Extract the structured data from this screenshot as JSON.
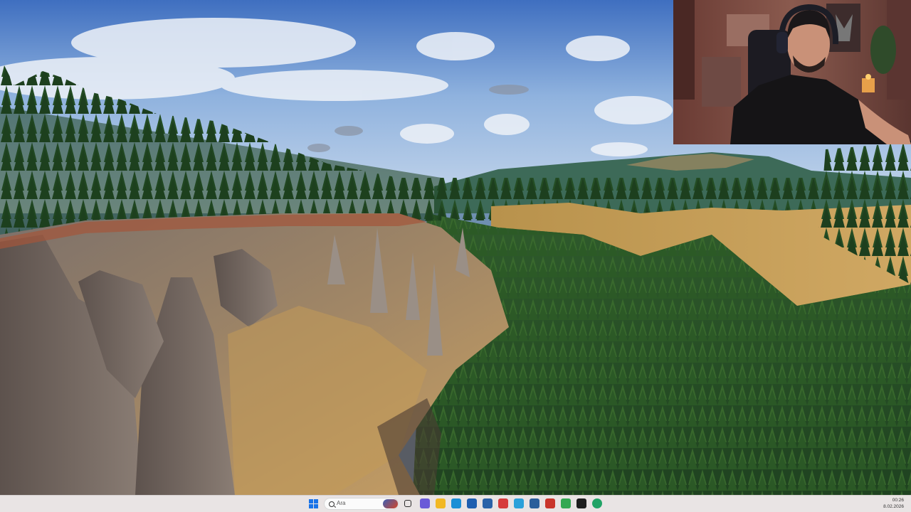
{
  "taskbar": {
    "search_placeholder": "Ara",
    "clock_time": "00:26",
    "clock_date": "8.02.2026",
    "pinned_apps": [
      {
        "name": "task-view-icon",
        "color": "#2b2b2b"
      },
      {
        "name": "copilot-icon",
        "color": "#6a5ad8"
      },
      {
        "name": "file-explorer-icon",
        "color": "#f2b824"
      },
      {
        "name": "edge-icon",
        "color": "#1b8fd6"
      },
      {
        "name": "store-icon",
        "color": "#1e5fb0"
      },
      {
        "name": "vpn-icon",
        "color": "#2a62a8"
      },
      {
        "name": "app-multicolor-icon",
        "color": "#d63c3c"
      },
      {
        "name": "telegram-icon",
        "color": "#2aa1da"
      },
      {
        "name": "document-app-icon",
        "color": "#2a5e9b"
      },
      {
        "name": "media-app-icon",
        "color": "#c9352b"
      },
      {
        "name": "chrome-icon",
        "color": "#34a853"
      },
      {
        "name": "obs-studio-icon",
        "color": "#1e1e1e"
      },
      {
        "name": "capture-app-icon",
        "color": "#21a366"
      }
    ]
  }
}
